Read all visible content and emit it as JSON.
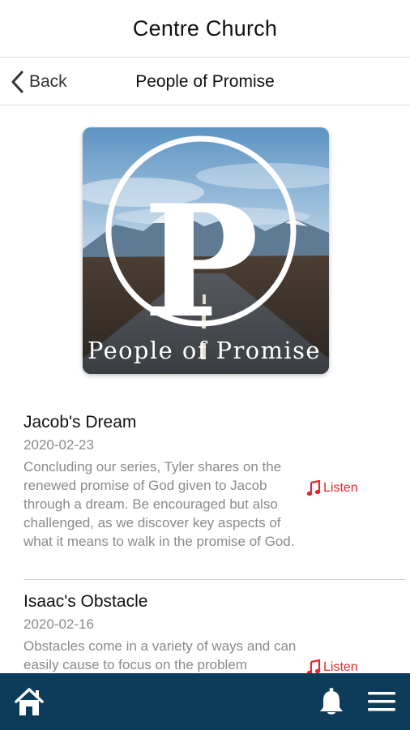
{
  "header": {
    "title": "Centre Church"
  },
  "nav": {
    "back_label": "Back",
    "title": "People of Promise"
  },
  "artwork": {
    "text": "People of Promise",
    "letter": "P"
  },
  "episodes": [
    {
      "title": "Jacob's Dream",
      "date": "2020-02-23",
      "description": "Concluding our series, Tyler shares on the renewed promise of God given to Jacob through a dream. Be encouraged but also challenged, as we discover key aspects of what it means to walk in the promise of God.",
      "listen_label": "Listen"
    },
    {
      "title": "Isaac's Obstacle",
      "date": "2020-02-16",
      "description": "Obstacles come in a variety of ways and can easily cause to focus on the problem",
      "listen_label": "Listen"
    }
  ],
  "tab_bar": {
    "icons": [
      "home-icon",
      "bell-icon",
      "menu-icon"
    ]
  },
  "colors": {
    "accent": "#e5262a",
    "tab_bar": "#0d3c5b",
    "secondary_text": "#8a8a8a"
  }
}
